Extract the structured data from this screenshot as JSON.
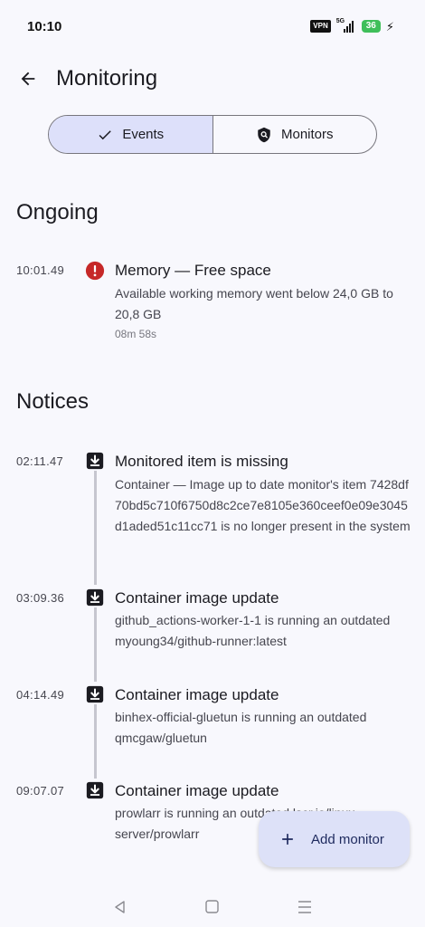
{
  "status_bar": {
    "time": "10:10",
    "vpn": "VPN",
    "network": "5G",
    "battery": "36"
  },
  "header": {
    "title": "Monitoring"
  },
  "tabs": [
    {
      "label": "Events",
      "selected": true
    },
    {
      "label": "Monitors",
      "selected": false
    }
  ],
  "ongoing": {
    "title": "Ongoing",
    "events": [
      {
        "time": "10:01.49",
        "title": "Memory — Free space",
        "description": "Available working memory went below 24,0 GB to 20,8 GB",
        "duration": "08m 58s",
        "icon": "error-icon",
        "icon_color": "#c62828"
      }
    ]
  },
  "notices": {
    "title": "Notices",
    "events": [
      {
        "time": "02:11.47",
        "title": "Monitored item is missing",
        "description": "Container — Image up to date monitor's item 7428df70bd5c710f6750d8c2ce7e8105e360ceef0e09e3045d1aded51c11cc71 is no longer present in the system",
        "icon": "download-box-icon"
      },
      {
        "time": "03:09.36",
        "title": "Container image update",
        "description": "github_actions-worker-1-1 is running an outdated myoung34/github-runner:latest",
        "icon": "download-box-icon"
      },
      {
        "time": "04:14.49",
        "title": "Container image update",
        "description": "binhex-official-gluetun is running an outdated qmcgaw/gluetun",
        "icon": "download-box-icon"
      },
      {
        "time": "09:07.07",
        "title": "Container image update",
        "description": "prowlarr is running an outdated lscr.io/linuxserver/prowlarr",
        "icon": "download-box-icon"
      }
    ]
  },
  "fab": {
    "label": "Add monitor"
  },
  "colors": {
    "accent_container": "#dde0fa",
    "error": "#c62828"
  }
}
